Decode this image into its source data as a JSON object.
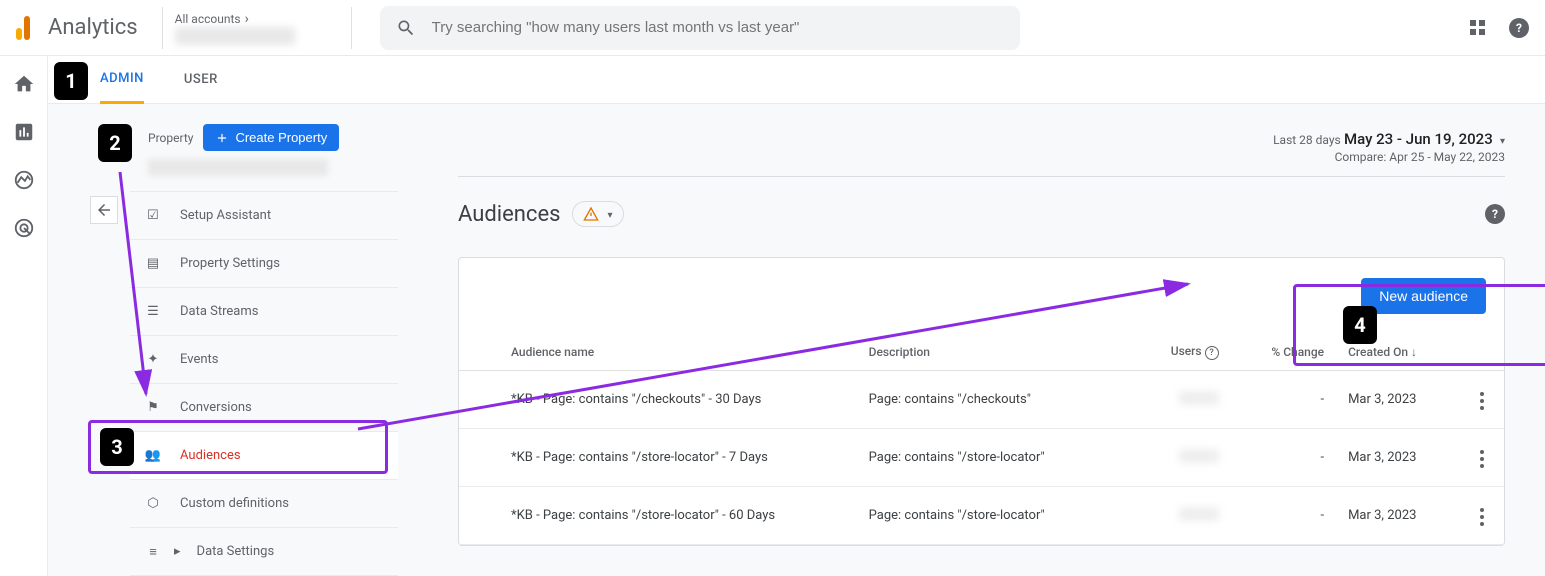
{
  "header": {
    "product": "Analytics",
    "account_label": "All accounts",
    "search_placeholder": "Try searching \"how many users last month vs last year\""
  },
  "tabs": {
    "admin": "ADMIN",
    "user": "USER"
  },
  "property": {
    "label": "Property",
    "create_button": "Create Property"
  },
  "menu": {
    "setup": "Setup Assistant",
    "settings": "Property Settings",
    "streams": "Data Streams",
    "events": "Events",
    "conversions": "Conversions",
    "audiences": "Audiences",
    "definitions": "Custom definitions",
    "data_settings": "Data Settings"
  },
  "date_range": {
    "preset": "Last 28 days",
    "range": "May 23 - Jun 19, 2023",
    "compare": "Compare: Apr 25 - May 22, 2023"
  },
  "page": {
    "title": "Audiences",
    "new_button": "New audience"
  },
  "table": {
    "headers": {
      "name": "Audience name",
      "desc": "Description",
      "users": "Users",
      "change": "% Change",
      "created": "Created On"
    },
    "rows": [
      {
        "name": "*KB - Page: contains \"/checkouts\" - 30 Days",
        "desc": "Page: contains \"/checkouts\"",
        "change": "-",
        "created": "Mar 3, 2023"
      },
      {
        "name": "*KB - Page: contains \"/store-locator\" - 7 Days",
        "desc": "Page: contains \"/store-locator\"",
        "change": "-",
        "created": "Mar 3, 2023"
      },
      {
        "name": "*KB - Page: contains \"/store-locator\" - 60 Days",
        "desc": "Page: contains \"/store-locator\"",
        "change": "-",
        "created": "Mar 3, 2023"
      }
    ]
  },
  "steps": {
    "s1": "1",
    "s2": "2",
    "s3": "3",
    "s4": "4"
  }
}
